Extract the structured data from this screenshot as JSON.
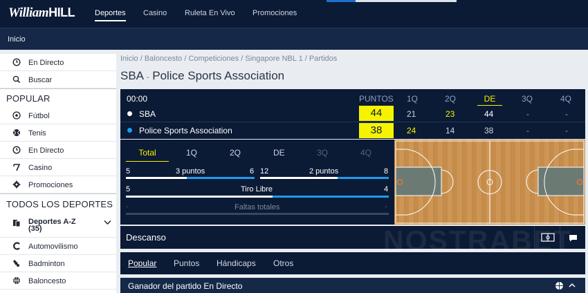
{
  "header": {
    "logo_script": "William",
    "logo_bold": "HILL",
    "nav": [
      "Deportes",
      "Casino",
      "Ruleta En Vivo",
      "Promociones"
    ],
    "active_nav": "Deportes"
  },
  "subbar": {
    "label": "Inicio"
  },
  "sidebar": {
    "top_items": [
      {
        "icon": "clock-icon",
        "label": "En Directo"
      },
      {
        "icon": "search-icon",
        "label": "Buscar"
      }
    ],
    "popular_heading": "POPULAR",
    "popular_items": [
      {
        "icon": "football-icon",
        "label": "Fútbol"
      },
      {
        "icon": "tennis-icon",
        "label": "Tenis"
      },
      {
        "icon": "clock-icon",
        "label": "En Directo"
      },
      {
        "icon": "slot-icon",
        "label": "Casino"
      },
      {
        "icon": "gear-icon",
        "label": "Promociones"
      }
    ],
    "all_sports_heading": "TODOS LOS DEPORTES",
    "az_label": "Deportes A-Z",
    "az_count": "(35)",
    "sports": [
      {
        "icon": "motorsport-icon",
        "label": "Automovilismo"
      },
      {
        "icon": "badminton-icon",
        "label": "Badminton"
      },
      {
        "icon": "basketball-icon",
        "label": "Baloncesto"
      }
    ]
  },
  "breadcrumb": "Inicio  /  Baloncesto  /  Competiciones  /  Singapore NBL 1  /  Partidos",
  "match": {
    "home": "SBA",
    "separator": "-",
    "away": "Police Sports Association"
  },
  "scoreboard": {
    "clock": "00:00",
    "headers": [
      "PUNTOS",
      "1Q",
      "2Q",
      "DE",
      "3Q",
      "4Q"
    ],
    "teams": [
      {
        "name": "SBA",
        "dot_color": "#ffffff",
        "points": "44",
        "q1": "21",
        "q2": "23",
        "de": "44",
        "q3": "-",
        "q4": "-"
      },
      {
        "name": "Police Sports Association",
        "dot_color": "#1e9bf0",
        "points": "38",
        "q1": "24",
        "q2": "14",
        "de": "38",
        "q3": "-",
        "q4": "-"
      }
    ]
  },
  "stats": {
    "tabs": [
      "Total",
      "1Q",
      "2Q",
      "DE",
      "3Q",
      "4Q"
    ],
    "active_tab": "Total",
    "three_points": {
      "home": "5",
      "label": "3 puntos",
      "away": "6"
    },
    "two_points": {
      "home": "12",
      "label": "2 puntos",
      "away": "8"
    },
    "free_throws": {
      "home": "5",
      "label": "Tiro Libre",
      "away": "4"
    },
    "fouls": {
      "home": "-",
      "label": "Faltas totales",
      "away": "-"
    }
  },
  "status": {
    "label": "Descanso"
  },
  "market_tabs": [
    "Popular",
    "Puntos",
    "Hándicaps",
    "Otros"
  ],
  "active_market_tab": "Popular",
  "market": {
    "title": "Ganador del partido En Directo"
  },
  "watermark": "NOSTRABET",
  "colors": {
    "navy": "#0b1a35",
    "accent_yellow": "#f6f300",
    "accent_blue": "#1e9bf0"
  }
}
